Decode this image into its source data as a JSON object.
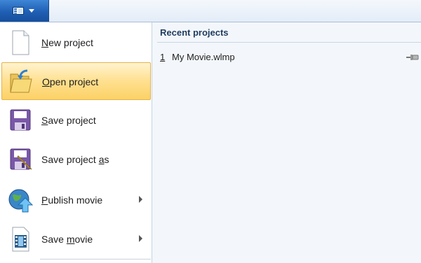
{
  "app_button": {
    "icon": "app-menu-icon"
  },
  "menu": {
    "items": [
      {
        "label": "New project",
        "mnemonic": "N",
        "icon": "new-project-icon",
        "submenu": false
      },
      {
        "label": "Open project",
        "mnemonic": "O",
        "icon": "open-folder-icon",
        "submenu": false,
        "hovered": true
      },
      {
        "label": "Save project",
        "mnemonic": "S",
        "icon": "save-disk-icon",
        "submenu": false
      },
      {
        "label": "Save project as",
        "mnemonic": "a",
        "icon": "save-as-icon",
        "submenu": false
      },
      {
        "label": "Publish movie",
        "mnemonic": "P",
        "icon": "publish-globe-icon",
        "submenu": true
      },
      {
        "label": "Save movie",
        "mnemonic": "m",
        "icon": "film-icon",
        "submenu": true
      }
    ]
  },
  "recent": {
    "title": "Recent projects",
    "items": [
      {
        "number": "1",
        "name": "My Movie.wlmp",
        "pin_icon": "pin-icon"
      }
    ]
  },
  "colors": {
    "accent": "#1f5fb4",
    "hover_fill": "#ffe08f",
    "hover_border": "#e4b34a"
  }
}
